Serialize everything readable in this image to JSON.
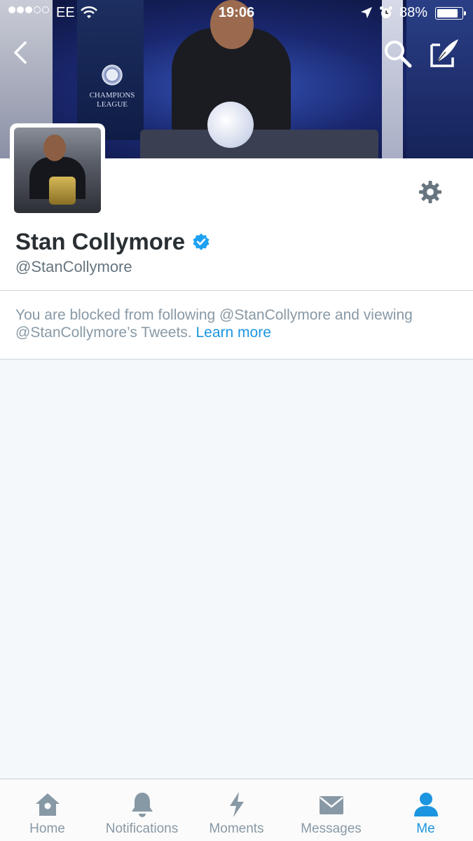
{
  "status_bar": {
    "carrier": "EE",
    "time": "19:06",
    "battery_percent": "88%",
    "battery_level": 0.88,
    "signal_bars": 3,
    "signal_total": 5
  },
  "banner": {
    "logo_text_1": "CHAMPIONS",
    "logo_text_2": "LEAGUE"
  },
  "profile": {
    "display_name": "Stan Collymore",
    "handle": "@StanCollymore",
    "verified": true
  },
  "blocked_notice": {
    "text": "You are blocked from following @StanCollymore and viewing @StanCollymore’s Tweets. ",
    "link_label": "Learn more"
  },
  "tab_bar": {
    "tabs": [
      {
        "label": "Home",
        "icon": "home-icon",
        "active": false
      },
      {
        "label": "Notifications",
        "icon": "bell-icon",
        "active": false
      },
      {
        "label": "Moments",
        "icon": "lightning-icon",
        "active": false
      },
      {
        "label": "Messages",
        "icon": "envelope-icon",
        "active": false
      },
      {
        "label": "Me",
        "icon": "person-icon",
        "active": true
      }
    ]
  },
  "colors": {
    "accent": "#1b95e0",
    "verified": "#1da1f2",
    "inactive_icon": "#8899a6",
    "background": "#f5f8fa"
  }
}
